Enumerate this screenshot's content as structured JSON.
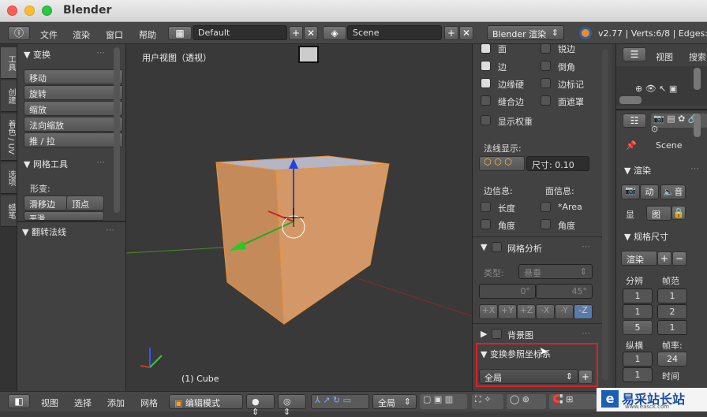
{
  "window": {
    "title": "Blender"
  },
  "menubar": {
    "items": [
      "文件",
      "渲染",
      "窗口",
      "帮助"
    ],
    "layout": "Default",
    "scene": "Scene",
    "engine": "Blender 渲染",
    "stats": "v2.77 | Verts:6/8 | Edges:7/"
  },
  "tabs": [
    "工具",
    "创建",
    "着色 / UV",
    "选项",
    "蜡笔"
  ],
  "tools_panel": {
    "transform_header": "▼ 变换",
    "transform_buttons": [
      "移动",
      "旋转",
      "缩放",
      "法向缩放",
      "推 / 拉"
    ],
    "mesh_header": "▼ 网格工具",
    "deform_label": "形变:",
    "deform_buttons": [
      "滑移边",
      "顶点"
    ],
    "smooth": "平滑",
    "flip_header": "▼ 翻转法线"
  },
  "viewport": {
    "label": "用户视图（透视）",
    "object": "(1) Cube"
  },
  "overlay": {
    "checks": [
      {
        "label": "面",
        "on": true
      },
      {
        "label": "锐边",
        "on": false
      },
      {
        "label": "边",
        "on": true
      },
      {
        "label": "倒角",
        "on": false
      },
      {
        "label": "边缘硬",
        "on": true
      },
      {
        "label": "边标记",
        "on": false
      },
      {
        "label": "缝合边",
        "on": false
      },
      {
        "label": "面遮罩",
        "on": false
      }
    ],
    "weights": "显示权重",
    "normals_label": "法线显示:",
    "size": "尺寸: 0.10",
    "edge_info": "边信息:",
    "face_info": "面信息:",
    "length": "长度",
    "area": "*Area",
    "angle1": "角度",
    "angle2": "角度",
    "mesh_analysis": "网格分析",
    "type_label": "类型:",
    "type_value": "悬垂",
    "range_min": "0°",
    "range_max": "45°",
    "axes": [
      "+X",
      "+Y",
      "+Z",
      "-X",
      "-Y",
      "-Z"
    ],
    "background": "背景图",
    "orient_header": "▼ 变换参照坐标系",
    "orient_value": "全局"
  },
  "right": {
    "view": "视图",
    "search": "搜索",
    "scene": "Scene",
    "render_header": "▼ 渲染",
    "render_btn": "渲染",
    "anim_btn": "动",
    "audio_btn": "音",
    "display": "显",
    "image": "图",
    "dims_header": "▼ 规格尺寸",
    "preset": "渲染",
    "resolution": "分辨",
    "frames": "帧范",
    "res_values": [
      "1",
      "1",
      "5"
    ],
    "frame_values": [
      "1",
      "2",
      "1"
    ],
    "aspect": "纵横",
    "framerate": "帧率:",
    "fps": "24",
    "time": "时间",
    "aspect_values": [
      "1",
      "1"
    ]
  },
  "bottombar": {
    "items": [
      "视图",
      "选择",
      "添加",
      "网格"
    ],
    "mode": "编辑模式",
    "pivot": "全局"
  },
  "watermark": {
    "site": "易采站长站",
    "url": "www.easck.com"
  }
}
